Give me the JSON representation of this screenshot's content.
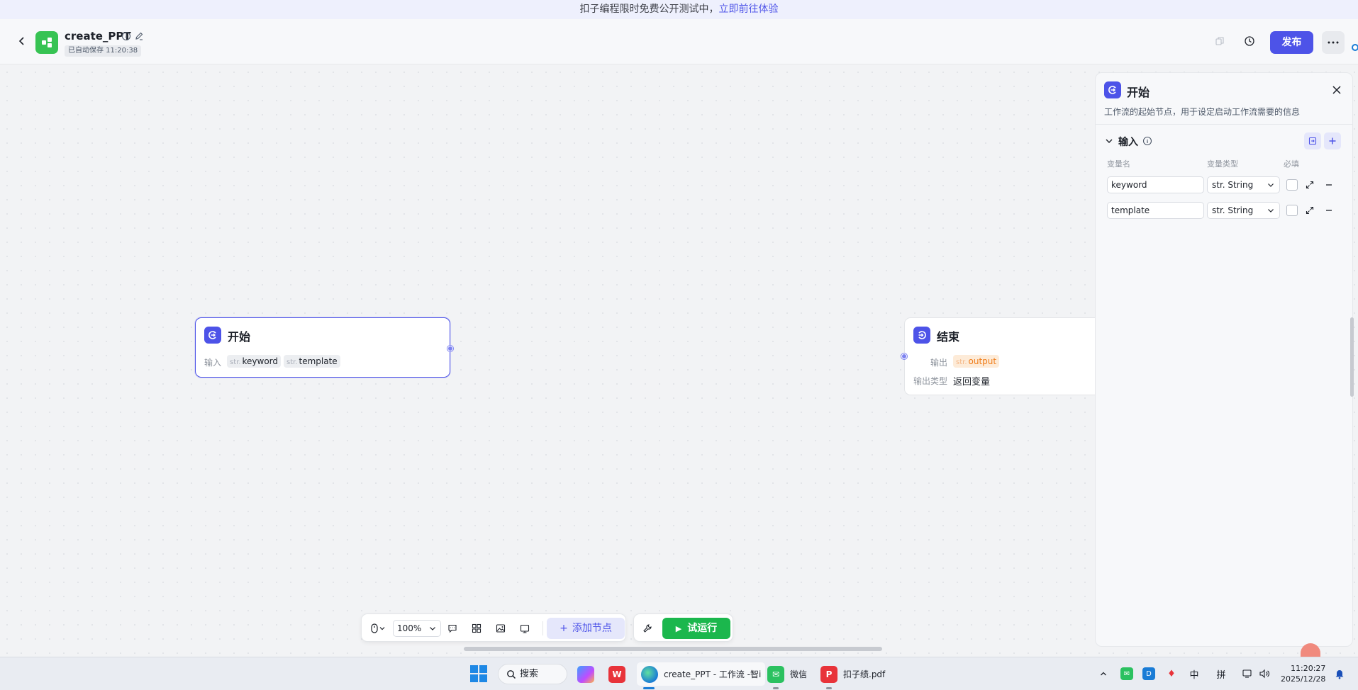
{
  "banner": {
    "text": "扣子编程限时免费公开测试中，",
    "link": "立即前往体验"
  },
  "header": {
    "app_title": "create_PPT",
    "save_status": "已自动保存 11:20:38",
    "publish_label": "发布"
  },
  "canvas": {
    "start_node": {
      "title": "开始",
      "input_label": "输入",
      "inputs": [
        {
          "type": "str.",
          "name": "keyword"
        },
        {
          "type": "str.",
          "name": "template"
        }
      ]
    },
    "end_node": {
      "title": "结束",
      "output_label": "输出",
      "output": {
        "type": "str.",
        "name": "output"
      },
      "output_type_label": "输出类型",
      "output_type_value": "返回变量"
    }
  },
  "panel": {
    "title": "开始",
    "description": "工作流的起始节点，用于设定启动工作流需要的信息",
    "section_title": "输入",
    "columns": {
      "name": "变量名",
      "type": "变量类型",
      "required": "必填"
    },
    "variables": [
      {
        "name": "keyword",
        "type": "str. String"
      },
      {
        "name": "template",
        "type": "str. String"
      }
    ]
  },
  "toolbar": {
    "zoom": "100%",
    "add_node_label": "添加节点",
    "run_label": "试运行"
  },
  "taskbar": {
    "search_label": "搜索",
    "apps": [
      {
        "label": "create_PPT - 工作流 -智i"
      },
      {
        "label": "微信"
      },
      {
        "label": "扣子绩.pdf"
      }
    ],
    "ime_lang": "中",
    "ime_mode": "拼",
    "time": "11:20:27",
    "date": "2025/12/28"
  },
  "colors": {
    "accent": "#4d53e8",
    "run_green": "#1bb74d",
    "output_orange": "#f07d1a",
    "logo_green": "#37c353"
  }
}
